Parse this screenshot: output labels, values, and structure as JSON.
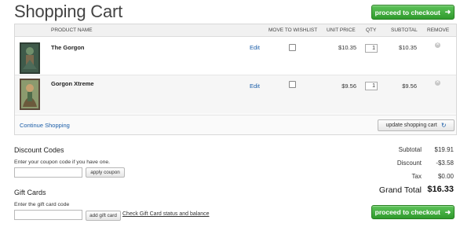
{
  "header": {
    "title": "Shopping Cart",
    "checkout_label": "proceed to checkout"
  },
  "table": {
    "columns": [
      "PRODUCT NAME",
      "MOVE TO WISHLIST",
      "UNIT PRICE",
      "QTY",
      "SUBTOTAL",
      "REMOVE"
    ],
    "rows": [
      {
        "name": "The Gorgon",
        "edit": "Edit",
        "unit_price": "$10.35",
        "qty": "1",
        "subtotal": "$10.35"
      },
      {
        "name": "Gorgon Xtreme",
        "edit": "Edit",
        "unit_price": "$9.56",
        "qty": "1",
        "subtotal": "$9.56"
      }
    ],
    "continue_label": "Continue Shopping",
    "update_label": "update shopping cart"
  },
  "discount": {
    "title": "Discount Codes",
    "hint": "Enter your coupon code if you have one.",
    "button": "apply coupon"
  },
  "gift": {
    "title": "Gift Cards",
    "hint": "Enter the gift card code",
    "button": "add gift card",
    "link": "Check Gift Card status and balance"
  },
  "summary": {
    "subtotal_label": "Subtotal",
    "subtotal": "$19.91",
    "discount_label": "Discount",
    "discount": "-$3.58",
    "tax_label": "Tax",
    "tax": "$0.00",
    "grand_label": "Grand Total",
    "grand": "$16.33"
  },
  "colors": {
    "accent_green": "#3aa836",
    "link_blue": "#1a5da8"
  }
}
